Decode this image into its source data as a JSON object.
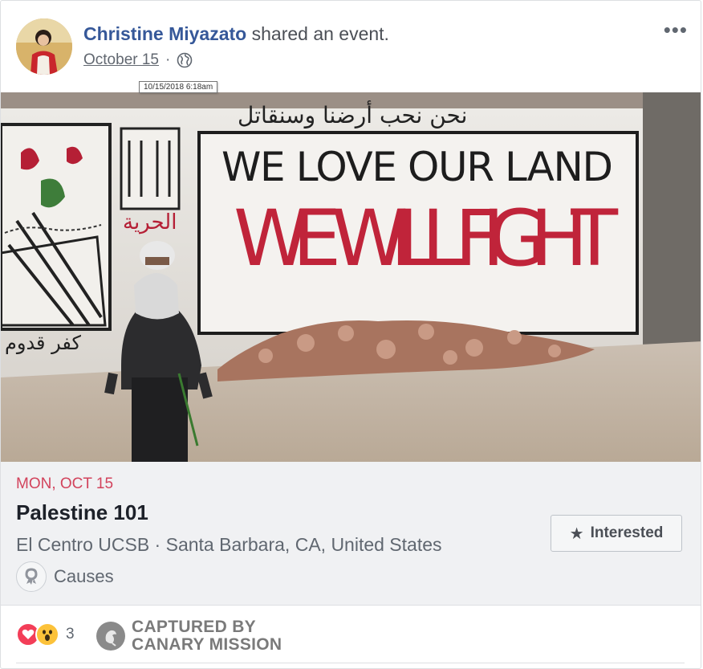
{
  "post": {
    "author": "Christine Miyazato",
    "action": " shared an event.",
    "date": "October 15",
    "separator": "·",
    "tooltip": "10/15/2018 6:18am",
    "privacy_icon": "globe-icon",
    "more_icon": "more-options-icon"
  },
  "photo": {
    "arabic_top": "نحن نحب أرضنا وسنقاتل",
    "line1": "WE LOVE OUR LAND",
    "line2": "WE WILL FIGHT",
    "arabic_side": "الحرية",
    "arabic_bottom": "كفر قدوم"
  },
  "event": {
    "date": "MON, OCT 15",
    "title": "Palestine 101",
    "location": "El Centro UCSB · Santa Barbara, CA, United States",
    "category": "Causes",
    "category_icon": "ribbon-icon",
    "interested_label": "Interested",
    "interested_icon": "star-icon"
  },
  "footer": {
    "reaction_count": "3",
    "reaction_icons": [
      "love-reaction-icon",
      "wow-reaction-icon"
    ],
    "watermark_line1": "CAPTURED BY",
    "watermark_line2": "CANARY MISSION"
  },
  "colors": {
    "link_blue": "#365899",
    "event_date_red": "#d2435c",
    "panel_bg": "#f0f1f3",
    "graffiti_red": "#c0243a"
  }
}
